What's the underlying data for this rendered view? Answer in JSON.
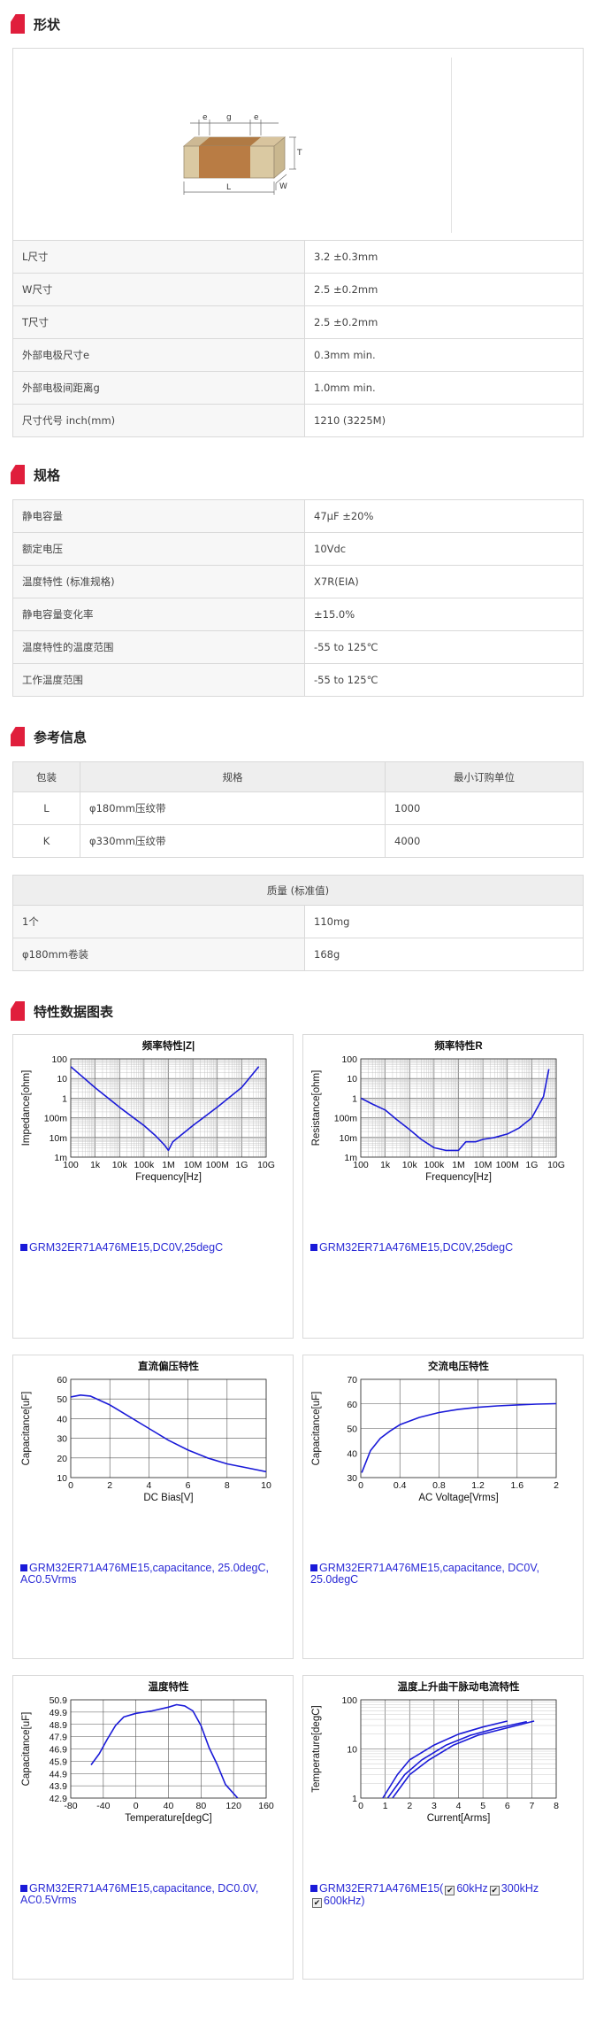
{
  "sections": {
    "shape": "形状",
    "spec": "规格",
    "ref": "参考信息",
    "charts": "特性数据图表"
  },
  "diagram": {
    "e": "e",
    "g": "g",
    "T": "T",
    "L": "L",
    "W": "W"
  },
  "dimensions": [
    {
      "k": "L尺寸",
      "v": "3.2 ±0.3mm"
    },
    {
      "k": "W尺寸",
      "v": "2.5 ±0.2mm"
    },
    {
      "k": "T尺寸",
      "v": "2.5 ±0.2mm"
    },
    {
      "k": "外部电极尺寸e",
      "v": "0.3mm min."
    },
    {
      "k": "外部电极间距离g",
      "v": "1.0mm min."
    },
    {
      "k": "尺寸代号 inch(mm)",
      "v": "1210 (3225M)"
    }
  ],
  "specs": [
    {
      "k": "静电容量",
      "v": "47μF ±20%"
    },
    {
      "k": "额定电压",
      "v": "10Vdc"
    },
    {
      "k": "温度特性 (标准规格)",
      "v": "X7R(EIA)"
    },
    {
      "k": "静电容量变化率",
      "v": "±15.0%"
    },
    {
      "k": "温度特性的温度范围",
      "v": "-55 to 125℃"
    },
    {
      "k": "工作温度范围",
      "v": "-55 to 125℃"
    }
  ],
  "packaging": {
    "headers": [
      "包装",
      "规格",
      "最小订购单位"
    ],
    "rows": [
      {
        "pkg": "L",
        "spec": "φ180mm压纹带",
        "moq": "1000"
      },
      {
        "pkg": "K",
        "spec": "φ330mm压纹带",
        "moq": "4000"
      }
    ]
  },
  "mass": {
    "header": "质量 (标准值)",
    "rows": [
      {
        "k": "1个",
        "v": "110mg"
      },
      {
        "k": "φ180mm卷装",
        "v": "168g"
      }
    ]
  },
  "legend_colors": {
    "series": "#1a1ad8",
    "text": "#2b2bd6",
    "accent": "#e01e3c"
  },
  "chart_data": [
    {
      "id": "impedance",
      "type": "line",
      "title": "频率特性|Z|",
      "xlabel": "Frequency[Hz]",
      "ylabel": "Impedance[ohm]",
      "xscale": "log",
      "yscale": "log",
      "xlim": [
        100,
        10000000000
      ],
      "ylim": [
        0.001,
        100
      ],
      "xticks": [
        "100",
        "1k",
        "10k",
        "100k",
        "1M",
        "10M",
        "100M",
        "1G",
        "10G"
      ],
      "yticks": [
        "1m",
        "10m",
        "100m",
        "1",
        "10",
        "100"
      ],
      "legend": "GRM32ER71A476ME15,DC0V,25degC",
      "series": [
        {
          "name": "GRM32ER71A476ME15,DC0V,25degC",
          "x": [
            100,
            1000,
            10000,
            100000,
            300000,
            700000,
            1000000,
            1500000,
            3000000,
            10000000,
            100000000,
            1000000000,
            5000000000
          ],
          "y": [
            40,
            3.4,
            0.34,
            0.04,
            0.012,
            0.004,
            0.0022,
            0.006,
            0.012,
            0.04,
            0.35,
            3.5,
            40
          ]
        }
      ]
    },
    {
      "id": "resistance",
      "type": "line",
      "title": "频率特性R",
      "xlabel": "Frequency[Hz]",
      "ylabel": "Resistance[ohm]",
      "xscale": "log",
      "yscale": "log",
      "xlim": [
        100,
        10000000000
      ],
      "ylim": [
        0.001,
        100
      ],
      "xticks": [
        "100",
        "1k",
        "10k",
        "100k",
        "1M",
        "10M",
        "100M",
        "1G",
        "10G"
      ],
      "yticks": [
        "1m",
        "10m",
        "100m",
        "1",
        "10",
        "100"
      ],
      "legend": "GRM32ER71A476ME15,DC0V,25degC",
      "series": [
        {
          "name": "GRM32ER71A476ME15,DC0V,25degC",
          "x": [
            100,
            300,
            1000,
            3000,
            10000,
            30000,
            100000,
            300000,
            1000000,
            2000000,
            5000000,
            10000000,
            30000000,
            100000000,
            300000000,
            1000000000,
            3000000000,
            5000000000
          ],
          "y": [
            1.0,
            0.5,
            0.25,
            0.08,
            0.025,
            0.008,
            0.003,
            0.0022,
            0.0022,
            0.006,
            0.006,
            0.008,
            0.01,
            0.015,
            0.03,
            0.1,
            1.2,
            30
          ]
        }
      ]
    },
    {
      "id": "dcbias",
      "type": "line",
      "title": "直流偏压特性",
      "xlabel": "DC Bias[V]",
      "ylabel": "Capacitance[uF]",
      "xlim": [
        0,
        10
      ],
      "ylim": [
        10,
        60
      ],
      "xticks": [
        "0",
        "2",
        "4",
        "6",
        "8",
        "10"
      ],
      "yticks": [
        "10",
        "20",
        "30",
        "40",
        "50",
        "60"
      ],
      "legend": "GRM32ER71A476ME15,capacitance, 25.0degC, AC0.5Vrms",
      "series": [
        {
          "name": "GRM32ER71A476ME15,capacitance, 25.0degC, AC0.5Vrms",
          "x": [
            0,
            0.5,
            1,
            2,
            3,
            4,
            5,
            6,
            7,
            8,
            9,
            10
          ],
          "y": [
            51,
            52,
            51.5,
            47,
            41,
            35,
            29,
            24,
            20,
            17,
            15,
            13
          ]
        }
      ]
    },
    {
      "id": "acvoltage",
      "type": "line",
      "title": "交流电压特性",
      "xlabel": "AC Voltage[Vrms]",
      "ylabel": "Capacitance[uF]",
      "xlim": [
        0,
        2
      ],
      "ylim": [
        30,
        70
      ],
      "xticks": [
        "0",
        "0.4",
        "0.8",
        "1.2",
        "1.6",
        "2"
      ],
      "yticks": [
        "30",
        "40",
        "50",
        "60",
        "70"
      ],
      "legend": "GRM32ER71A476ME15,capacitance, DC0V, 25.0degC",
      "series": [
        {
          "name": "GRM32ER71A476ME15,capacitance, DC0V, 25.0degC",
          "x": [
            0.01,
            0.1,
            0.2,
            0.3,
            0.4,
            0.6,
            0.8,
            1.0,
            1.2,
            1.4,
            1.6,
            1.8,
            2.0
          ],
          "y": [
            32,
            41,
            46,
            49,
            51.5,
            54.5,
            56.5,
            57.8,
            58.6,
            59.2,
            59.6,
            59.9,
            60.1
          ]
        }
      ]
    },
    {
      "id": "temperature",
      "type": "line",
      "title": "温度特性",
      "xlabel": "Temperature[degC]",
      "ylabel": "Capacitance[uF]",
      "xlim": [
        -80,
        160
      ],
      "ylim": [
        42.9,
        50.9
      ],
      "xticks": [
        "-80",
        "-40",
        "0",
        "40",
        "80",
        "120",
        "160"
      ],
      "yticks": [
        "42.9",
        "43.9",
        "44.9",
        "45.9",
        "46.9",
        "47.9",
        "48.9",
        "49.9",
        "50.9"
      ],
      "legend": "GRM32ER71A476ME15,capacitance, DC0.0V, AC0.5Vrms",
      "series": [
        {
          "name": "GRM32ER71A476ME15,capacitance, DC0.0V, AC0.5Vrms",
          "x": [
            -55,
            -45,
            -35,
            -25,
            -15,
            0,
            20,
            40,
            50,
            60,
            70,
            80,
            90,
            100,
            110,
            125
          ],
          "y": [
            45.6,
            46.5,
            47.7,
            48.8,
            49.5,
            49.8,
            50.0,
            50.3,
            50.5,
            50.4,
            50.0,
            48.8,
            47.0,
            45.6,
            44.0,
            42.9
          ]
        }
      ]
    },
    {
      "id": "ripple",
      "type": "line",
      "title": "温度上升曲干脉动电流特性",
      "xlabel": "Current[Arms]",
      "ylabel": "Temperature[degC]",
      "yscale": "log",
      "xlim": [
        0,
        8
      ],
      "ylim": [
        1,
        100
      ],
      "xticks": [
        "0",
        "1",
        "2",
        "3",
        "4",
        "5",
        "6",
        "7",
        "8"
      ],
      "yticks": [
        "1",
        "10",
        "100"
      ],
      "legend_prefix": "GRM32ER71A476ME15(",
      "legend_items": [
        "60kHz",
        "300kHz",
        "600kHz)"
      ],
      "series": [
        {
          "name": "60kHz",
          "x": [
            0.9,
            1.5,
            2,
            3,
            4,
            5,
            6
          ],
          "y": [
            1,
            3,
            6,
            12,
            20,
            28,
            37
          ]
        },
        {
          "name": "300kHz",
          "x": [
            1.1,
            1.8,
            2.5,
            3.5,
            4.5,
            5.5,
            6.8
          ],
          "y": [
            1,
            3,
            6,
            12,
            19,
            26,
            36
          ]
        },
        {
          "name": "600kHz",
          "x": [
            1.3,
            2,
            2.8,
            3.8,
            4.8,
            6,
            7.1
          ],
          "y": [
            1,
            3,
            6,
            12,
            19,
            27,
            37
          ]
        }
      ]
    }
  ]
}
